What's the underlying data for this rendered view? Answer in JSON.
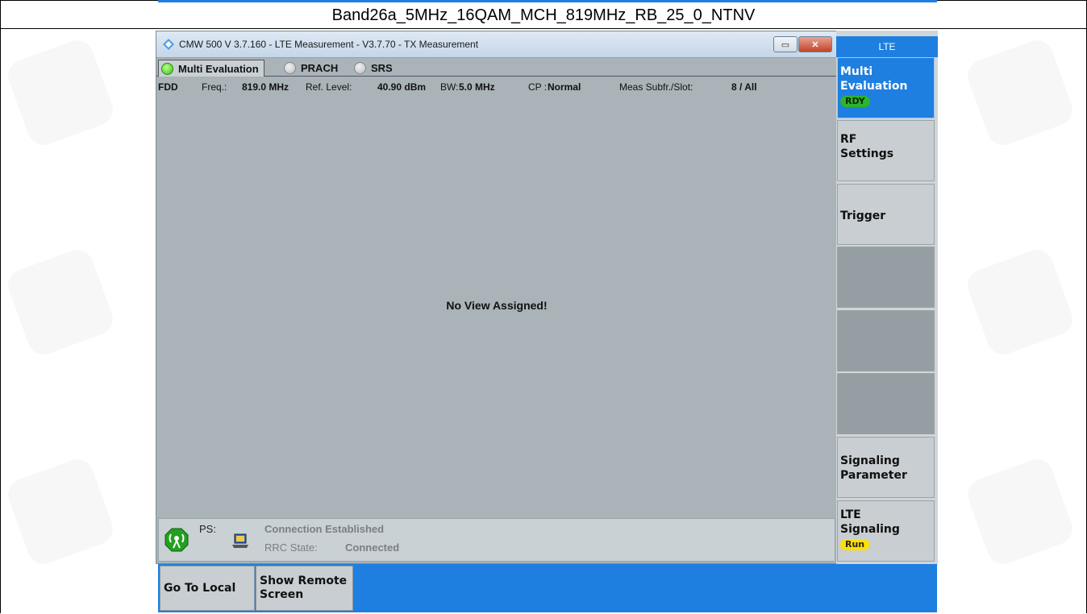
{
  "caption": "Band26a_5MHz_16QAM_MCH_819MHz_RB_25_0_NTNV",
  "window": {
    "title": "CMW 500 V 3.7.160 - LTE Measurement  - V3.7.70 - TX Measurement",
    "minimize_glyph": "▭",
    "close_glyph": "✕"
  },
  "tabs": [
    {
      "label": "Multi Evaluation",
      "state": "active",
      "led": "green"
    },
    {
      "label": "PRACH",
      "state": "inactive",
      "led": "grey"
    },
    {
      "label": "SRS",
      "state": "inactive",
      "led": "grey"
    }
  ],
  "info": {
    "duplex": "FDD",
    "freq_label": "Freq.:",
    "freq_value": "819.0 MHz",
    "ref_level_label": "Ref. Level:",
    "ref_level_value": "40.90 dBm",
    "bw_label": "BW:",
    "bw_value": "5.0 MHz",
    "cp_label": "CP :",
    "cp_value": "Normal",
    "meas_label": "Meas Subfr./Slot:",
    "meas_value": "8  / All"
  },
  "main_message": "No View Assigned!",
  "status": {
    "ps_label": "PS:",
    "connection": "Connection Established",
    "rrc_label": "RRC State:",
    "rrc_value": "Connected"
  },
  "softkeys": {
    "header": "LTE",
    "multi_eval_line1": "Multi",
    "multi_eval_line2": "Evaluation",
    "multi_eval_badge": "RDY",
    "rf_line1": "RF",
    "rf_line2": "Settings",
    "trigger": "Trigger",
    "sig_param_line1": "Signaling",
    "sig_param_line2": "Parameter",
    "lte_sig_line1": "LTE",
    "lte_sig_line2": "Signaling",
    "lte_sig_badge": "Run"
  },
  "bottom": {
    "go_to_local": "Go To Local",
    "show_remote_line1": "Show Remote",
    "show_remote_line2": "Screen"
  },
  "colors": {
    "accent_blue": "#1e7fe0",
    "window_bg": "#a9b3b8",
    "status_ready": "#2bb52b",
    "status_run": "#ffe000"
  },
  "icons": [
    "app-icon",
    "minimize-icon",
    "close-icon",
    "led-green-icon",
    "led-grey-icon",
    "antenna-icon",
    "laptop-icon"
  ]
}
